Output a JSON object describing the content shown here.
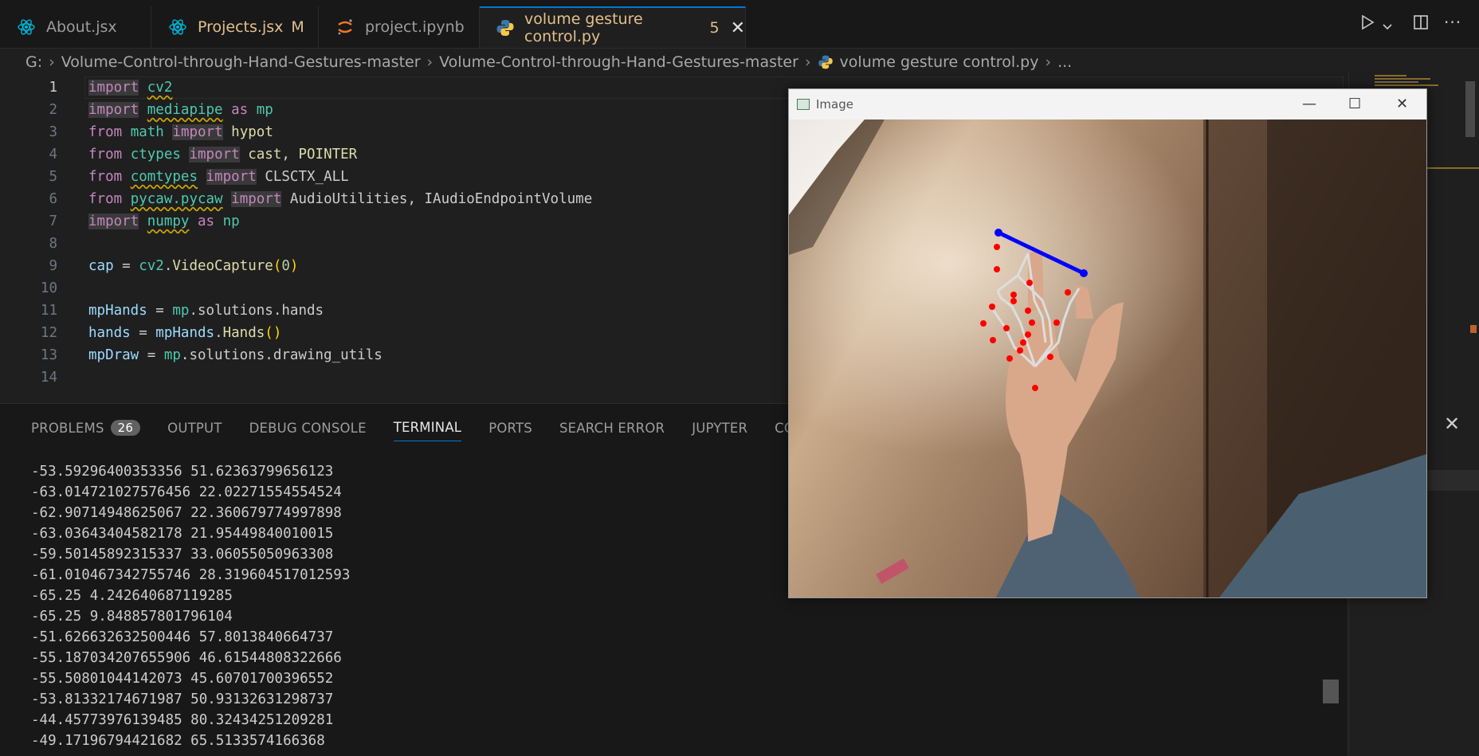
{
  "tabs": [
    {
      "label": "About.jsx",
      "icon": "react-icon"
    },
    {
      "label": "Projects.jsx",
      "icon": "react-icon",
      "badge": "M"
    },
    {
      "label": "project.ipynb",
      "icon": "jupyter-icon"
    },
    {
      "label": "volume gesture control.py",
      "icon": "python-icon",
      "badge": "5",
      "close": "✕"
    }
  ],
  "breadcrumb": {
    "drive": "G:",
    "parts": [
      "Volume-Control-through-Hand-Gestures-master",
      "Volume-Control-through-Hand-Gestures-master",
      "volume gesture control.py",
      "..."
    ]
  },
  "editor": {
    "line_numbers": [
      "1",
      "2",
      "3",
      "4",
      "5",
      "6",
      "7",
      "8",
      "9",
      "10",
      "11",
      "12",
      "13",
      "14"
    ],
    "lines": [
      "import cv2",
      "import mediapipe as mp",
      "from math import hypot",
      "from ctypes import cast, POINTER",
      "from comtypes import CLSCTX_ALL",
      "from pycaw.pycaw import AudioUtilities, IAudioEndpointVolume",
      "import numpy as np",
      "",
      "cap = cv2.VideoCapture(0)",
      "",
      "mpHands = mp.solutions.hands",
      "hands = mpHands.Hands()",
      "mpDraw = mp.solutions.drawing_utils",
      ""
    ]
  },
  "panel": {
    "tabs": [
      "PROBLEMS",
      "OUTPUT",
      "DEBUG CONSOLE",
      "TERMINAL",
      "PORTS",
      "SEARCH ERROR",
      "JUPYTER",
      "COMMENTS"
    ],
    "problems_count": "26",
    "active_tab": "TERMINAL",
    "close": "✕"
  },
  "terminal": [
    "-53.59296400353356 51.62363799656123",
    "-63.014721027576456 22.02271554554524",
    "-62.90714948625067 22.360679774997898",
    "-63.03643404582178 21.95449840010015",
    "-59.50145892315337 33.06055050963308",
    "-61.010467342755746 28.319604517012593",
    "-65.25 4.242640687119285",
    "-65.25 9.848857801796104",
    "-51.626632632500446 57.8013840664737",
    "-55.187034207655906 46.61544808322666",
    "-55.50801044142073 45.60701700396552",
    "-53.81332174671987 50.93132631298737",
    "-44.45773976139485 80.32434251209281",
    "-49.17196794421682 65.5133574166368"
  ],
  "image_window": {
    "title": "Image",
    "controls": {
      "minimize": "—",
      "maximize": "☐",
      "close": "✕"
    }
  },
  "colors": {
    "accent": "#0078d4",
    "modified": "#e2c08d",
    "landmark": "#ff0000",
    "connector": "#0000ff"
  }
}
